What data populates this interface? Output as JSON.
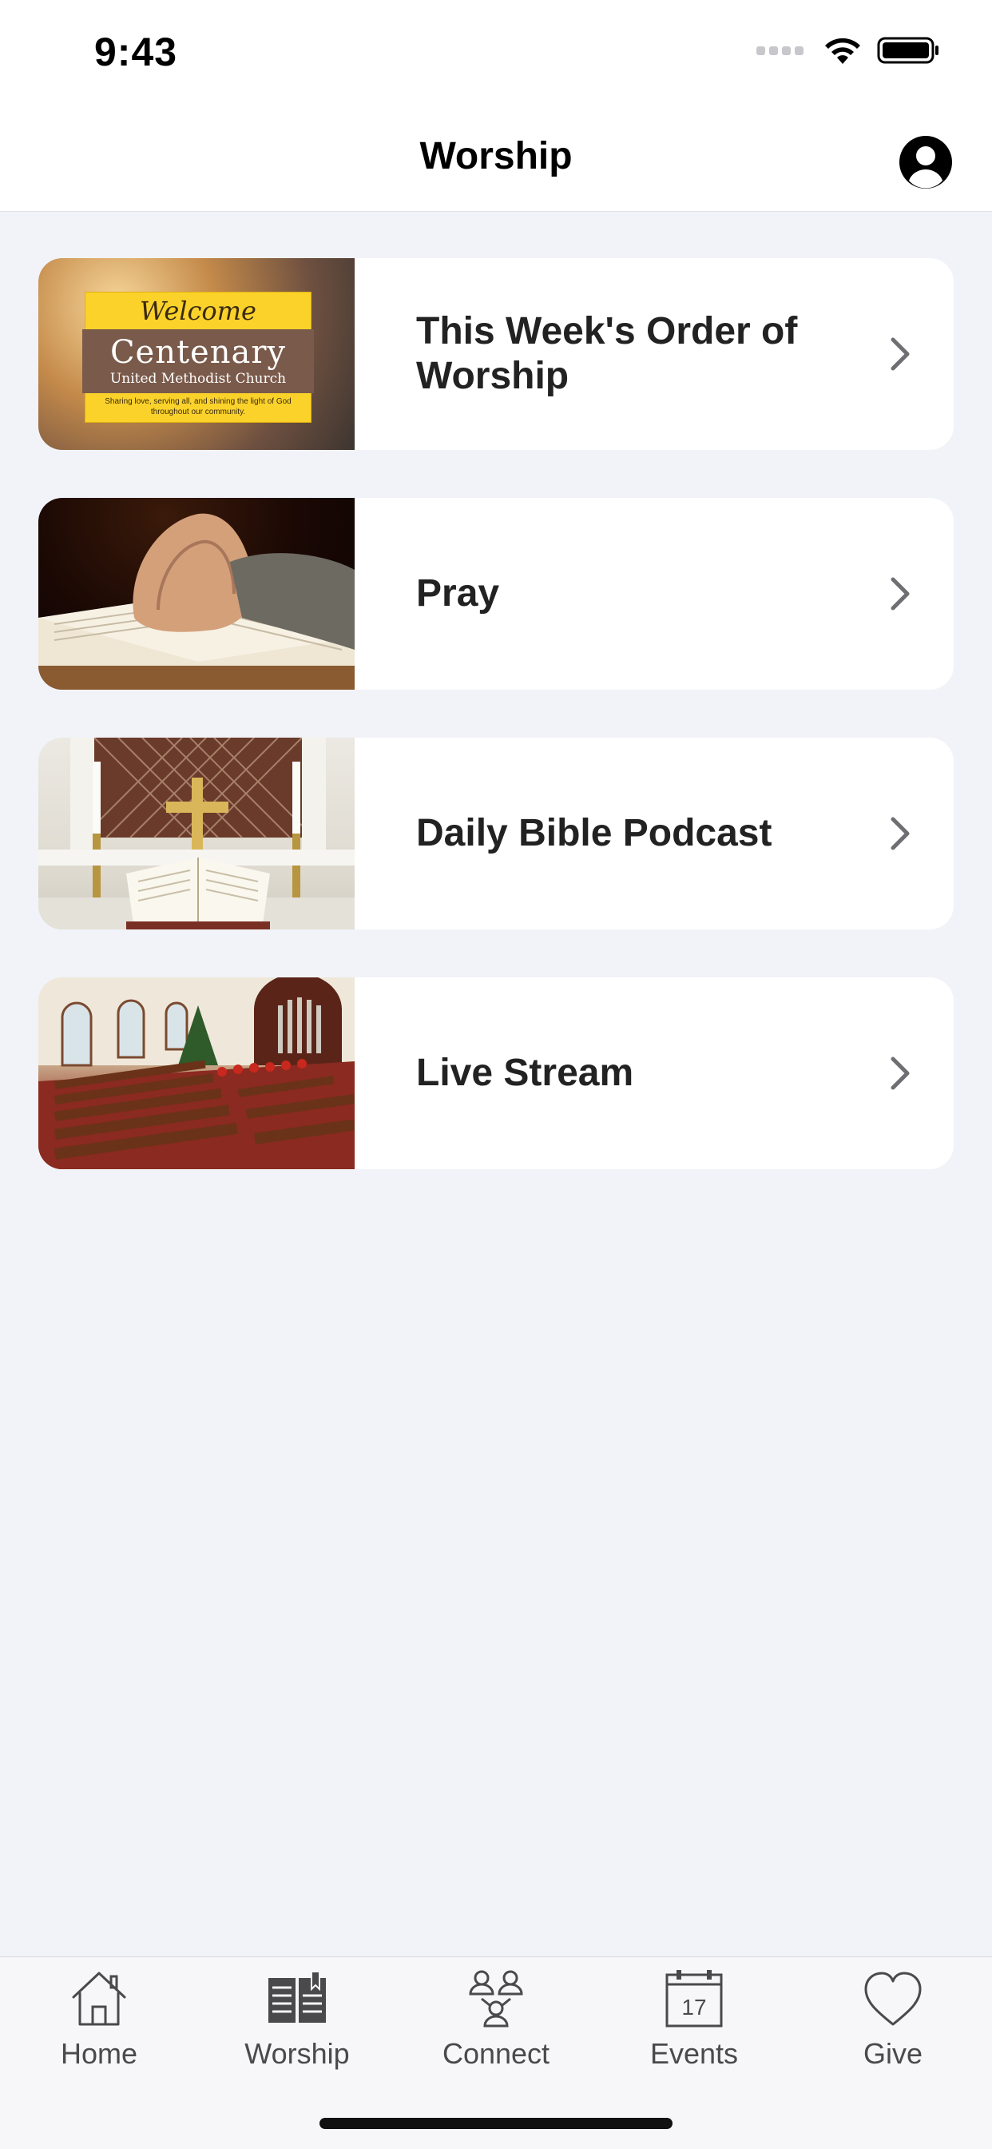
{
  "status_bar": {
    "time": "9:43"
  },
  "nav": {
    "title": "Worship"
  },
  "items": [
    {
      "title": "This Week's Order of Worship",
      "thumbnail": {
        "heading": "Welcome",
        "name": "Centenary",
        "subtitle": "United Methodist Church",
        "tagline": "Sharing love, serving all, and shining the light of God throughout our community."
      }
    },
    {
      "title": "Pray"
    },
    {
      "title": "Daily Bible Podcast"
    },
    {
      "title": "Live Stream"
    }
  ],
  "tabs": [
    {
      "label": "Home",
      "icon": "house-icon"
    },
    {
      "label": "Worship",
      "icon": "book-icon"
    },
    {
      "label": "Connect",
      "icon": "people-icon"
    },
    {
      "label": "Events",
      "icon": "calendar-icon",
      "calendar_day": "17"
    },
    {
      "label": "Give",
      "icon": "heart-icon"
    }
  ]
}
